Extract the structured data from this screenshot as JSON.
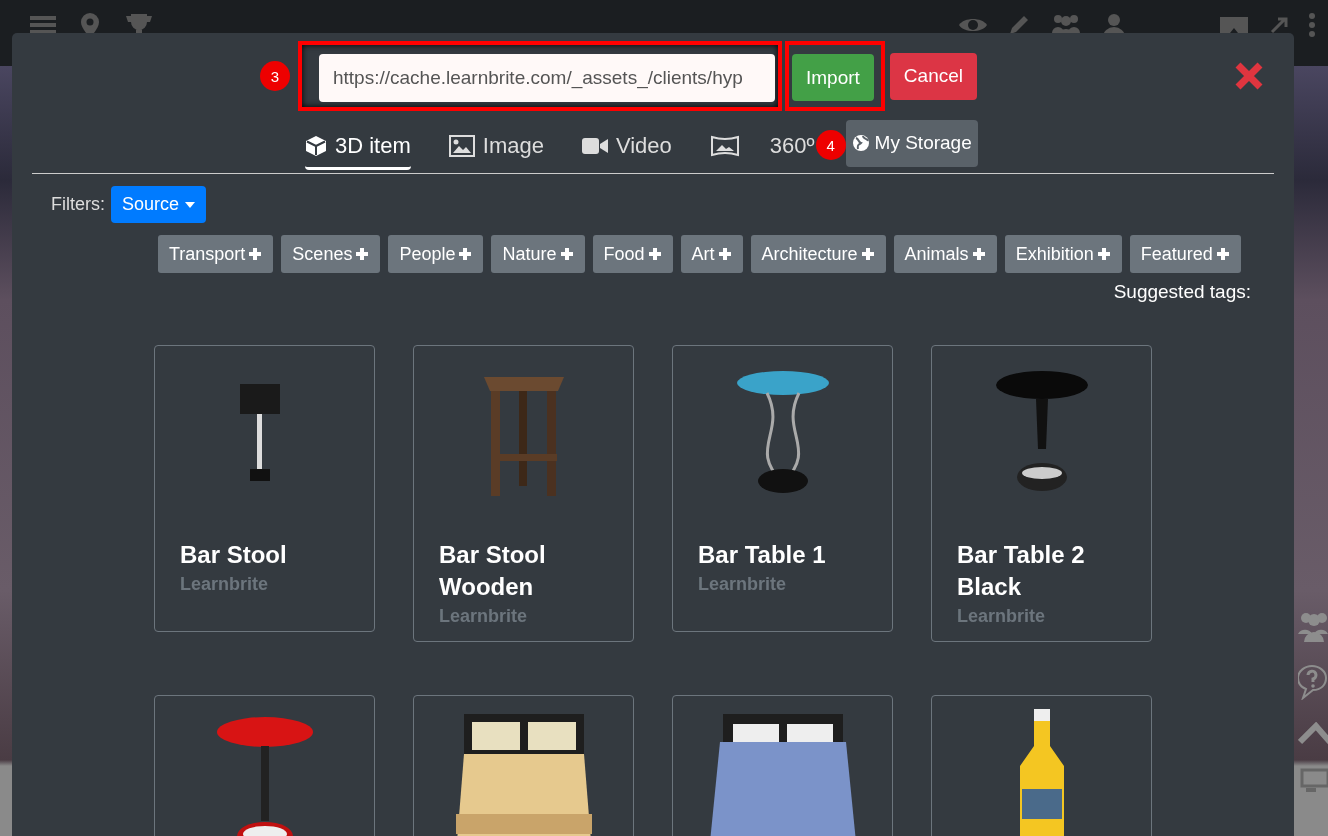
{
  "url_field": {
    "value": "https://cache.learnbrite.com/_assets_/clients/hyp"
  },
  "step_markers": [
    "3",
    "4"
  ],
  "buttons": [
    {
      "kind": "import",
      "label": "Import"
    },
    {
      "kind": "cancel",
      "label": "Cancel"
    }
  ],
  "tabs": [
    {
      "kind": "cube",
      "label": "3D item",
      "selected": true
    },
    {
      "kind": "image",
      "label": "Image",
      "selected": false
    },
    {
      "kind": "video",
      "label": "Video",
      "selected": false
    },
    {
      "kind": "panorama",
      "label": "360º",
      "selected": false
    }
  ],
  "storage_button": {
    "label": "My Storage"
  },
  "filters": {
    "label": "Filters:",
    "dropdown": "Source"
  },
  "tags": [
    "Transport",
    "Scenes",
    "People",
    "Nature",
    "Food",
    "Art",
    "Architecture",
    "Animals",
    "Exhibition",
    "Featured"
  ],
  "suggested_label": "Suggested tags:",
  "items": [
    {
      "kind": "stool",
      "title": "Bar Stool",
      "source": "Learnbrite"
    },
    {
      "kind": "wooden_stool",
      "title": "Bar Stool Wooden",
      "source": "Learnbrite"
    },
    {
      "kind": "glass_table",
      "title": "Bar Table 1",
      "source": "Learnbrite"
    },
    {
      "kind": "black_table",
      "title": "Bar Table 2 Black",
      "source": "Learnbrite"
    },
    {
      "kind": "red_table"
    },
    {
      "kind": "bed"
    },
    {
      "kind": "blue_bed"
    },
    {
      "kind": "bottle"
    }
  ]
}
